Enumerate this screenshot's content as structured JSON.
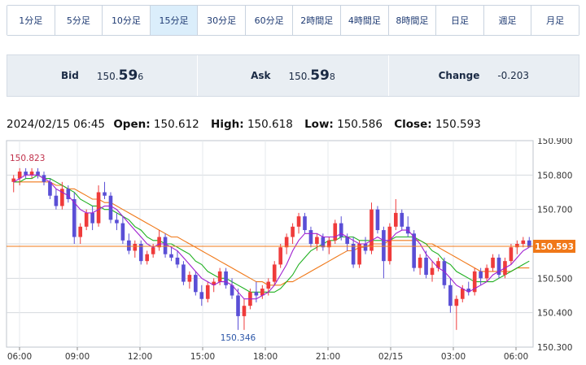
{
  "timeframes": [
    {
      "label": "1分足",
      "active": false
    },
    {
      "label": "5分足",
      "active": false
    },
    {
      "label": "10分足",
      "active": false
    },
    {
      "label": "15分足",
      "active": true
    },
    {
      "label": "30分足",
      "active": false
    },
    {
      "label": "60分足",
      "active": false
    },
    {
      "label": "2時間足",
      "active": false
    },
    {
      "label": "4時間足",
      "active": false
    },
    {
      "label": "8時間足",
      "active": false
    },
    {
      "label": "日足",
      "active": false
    },
    {
      "label": "週足",
      "active": false
    },
    {
      "label": "月足",
      "active": false
    }
  ],
  "quotes": {
    "bid": {
      "label": "Bid",
      "prefix": "150.",
      "big": "59",
      "small": "6"
    },
    "ask": {
      "label": "Ask",
      "prefix": "150.",
      "big": "59",
      "small": "8"
    },
    "change": {
      "label": "Change",
      "value": "-0.203"
    }
  },
  "ohlc": {
    "datetime": "2024/02/15 06:45",
    "open_label": "Open:",
    "open": "150.612",
    "high_label": "High:",
    "high": "150.618",
    "low_label": "Low:",
    "low": "150.586",
    "close_label": "Close:",
    "close": "150.593"
  },
  "colors": {
    "up": "#ef3b3b",
    "down": "#5a4fd6",
    "ma_fast": "#a020d0",
    "ma_mid": "#20b020",
    "ma_slow": "#f07818",
    "current_line": "#f07818"
  },
  "chart_data": {
    "type": "candlestick",
    "ylim": [
      150.3,
      150.9
    ],
    "yticks": [
      "150.900",
      "150.800",
      "150.700",
      "150.600",
      "150.500",
      "150.400",
      "150.300"
    ],
    "xticks": [
      "06:00",
      "09:00",
      "12:00",
      "15:00",
      "18:00",
      "21:00",
      "02/15",
      "03:00",
      "06:00"
    ],
    "current_price": "150.593",
    "annotations": {
      "max_label": "150.823",
      "min_label": "150.346"
    },
    "candles": [
      [
        150.78,
        150.8,
        150.75,
        150.79
      ],
      [
        150.79,
        150.82,
        150.77,
        150.81
      ],
      [
        150.81,
        150.82,
        150.79,
        150.8
      ],
      [
        150.8,
        150.82,
        150.79,
        150.81
      ],
      [
        150.81,
        150.82,
        150.79,
        150.8
      ],
      [
        150.8,
        150.81,
        150.77,
        150.78
      ],
      [
        150.78,
        150.79,
        150.73,
        150.74
      ],
      [
        150.74,
        150.76,
        150.7,
        150.71
      ],
      [
        150.71,
        150.78,
        150.7,
        150.76
      ],
      [
        150.76,
        150.77,
        150.72,
        150.73
      ],
      [
        150.73,
        150.75,
        150.6,
        150.62
      ],
      [
        150.62,
        150.66,
        150.6,
        150.65
      ],
      [
        150.65,
        150.7,
        150.64,
        150.69
      ],
      [
        150.69,
        150.71,
        150.64,
        150.66
      ],
      [
        150.66,
        150.77,
        150.65,
        150.75
      ],
      [
        150.75,
        150.78,
        150.73,
        150.74
      ],
      [
        150.74,
        150.75,
        150.66,
        150.67
      ],
      [
        150.67,
        150.69,
        150.64,
        150.66
      ],
      [
        150.66,
        150.68,
        150.6,
        150.61
      ],
      [
        150.61,
        150.63,
        150.57,
        150.58
      ],
      [
        150.58,
        150.61,
        150.56,
        150.6
      ],
      [
        150.6,
        150.61,
        150.54,
        150.55
      ],
      [
        150.55,
        150.58,
        150.54,
        150.57
      ],
      [
        150.57,
        150.6,
        150.56,
        150.59
      ],
      [
        150.59,
        150.64,
        150.58,
        150.62
      ],
      [
        150.62,
        150.63,
        150.56,
        150.57
      ],
      [
        150.57,
        150.59,
        150.55,
        150.56
      ],
      [
        150.56,
        150.58,
        150.53,
        150.54
      ],
      [
        150.54,
        150.55,
        150.48,
        150.49
      ],
      [
        150.49,
        150.52,
        150.47,
        150.51
      ],
      [
        150.51,
        150.52,
        150.45,
        150.46
      ],
      [
        150.46,
        150.48,
        150.42,
        150.44
      ],
      [
        150.44,
        150.49,
        150.43,
        150.48
      ],
      [
        150.48,
        150.5,
        150.46,
        150.49
      ],
      [
        150.49,
        150.53,
        150.48,
        150.52
      ],
      [
        150.52,
        150.53,
        150.47,
        150.48
      ],
      [
        150.48,
        150.5,
        150.44,
        150.45
      ],
      [
        150.45,
        150.47,
        150.35,
        150.39
      ],
      [
        150.39,
        150.44,
        150.35,
        150.42
      ],
      [
        150.42,
        150.47,
        150.41,
        150.46
      ],
      [
        150.46,
        150.49,
        150.43,
        150.45
      ],
      [
        150.45,
        150.48,
        150.44,
        150.47
      ],
      [
        150.47,
        150.5,
        150.45,
        150.49
      ],
      [
        150.49,
        150.55,
        150.48,
        150.54
      ],
      [
        150.54,
        150.6,
        150.53,
        150.59
      ],
      [
        150.59,
        150.63,
        150.57,
        150.62
      ],
      [
        150.62,
        150.66,
        150.6,
        150.65
      ],
      [
        150.65,
        150.69,
        150.63,
        150.68
      ],
      [
        150.68,
        150.69,
        150.63,
        150.64
      ],
      [
        150.64,
        150.65,
        150.59,
        150.6
      ],
      [
        150.6,
        150.63,
        150.58,
        150.62
      ],
      [
        150.62,
        150.63,
        150.58,
        150.59
      ],
      [
        150.59,
        150.62,
        150.57,
        150.61
      ],
      [
        150.61,
        150.67,
        150.6,
        150.66
      ],
      [
        150.66,
        150.68,
        150.61,
        150.62
      ],
      [
        150.62,
        150.63,
        150.58,
        150.6
      ],
      [
        150.6,
        150.62,
        150.53,
        150.54
      ],
      [
        150.54,
        150.61,
        150.53,
        150.6
      ],
      [
        150.6,
        150.62,
        150.57,
        150.58
      ],
      [
        150.58,
        150.72,
        150.57,
        150.7
      ],
      [
        150.7,
        150.71,
        150.63,
        150.64
      ],
      [
        150.64,
        150.65,
        150.5,
        150.55
      ],
      [
        150.55,
        150.66,
        150.54,
        150.65
      ],
      [
        150.65,
        150.73,
        150.64,
        150.69
      ],
      [
        150.69,
        150.7,
        150.64,
        150.65
      ],
      [
        150.65,
        150.68,
        150.62,
        150.63
      ],
      [
        150.63,
        150.64,
        150.52,
        150.53
      ],
      [
        150.53,
        150.57,
        150.51,
        150.56
      ],
      [
        150.56,
        150.58,
        150.5,
        150.51
      ],
      [
        150.51,
        150.55,
        150.49,
        150.53
      ],
      [
        150.53,
        150.56,
        150.52,
        150.55
      ],
      [
        150.55,
        150.56,
        150.47,
        150.48
      ],
      [
        150.48,
        150.5,
        150.4,
        150.42
      ],
      [
        150.42,
        150.45,
        150.35,
        150.44
      ],
      [
        150.44,
        150.48,
        150.43,
        150.47
      ],
      [
        150.47,
        150.49,
        150.45,
        150.46
      ],
      [
        150.46,
        150.53,
        150.45,
        150.52
      ],
      [
        150.52,
        150.53,
        150.48,
        150.5
      ],
      [
        150.5,
        150.54,
        150.49,
        150.53
      ],
      [
        150.53,
        150.57,
        150.52,
        150.56
      ],
      [
        150.56,
        150.57,
        150.5,
        150.51
      ],
      [
        150.51,
        150.56,
        150.5,
        150.55
      ],
      [
        150.55,
        150.6,
        150.54,
        150.59
      ],
      [
        150.59,
        150.61,
        150.57,
        150.6
      ],
      [
        150.6,
        150.62,
        150.59,
        150.61
      ],
      [
        150.61,
        150.62,
        150.59,
        150.59
      ]
    ],
    "ma_fast": [
      150.78,
      150.79,
      150.8,
      150.8,
      150.8,
      150.79,
      150.78,
      150.76,
      150.75,
      150.74,
      150.72,
      150.7,
      150.69,
      150.69,
      150.7,
      150.71,
      150.71,
      150.7,
      150.68,
      150.66,
      150.64,
      150.62,
      150.6,
      150.59,
      150.6,
      150.6,
      150.59,
      150.58,
      150.56,
      150.54,
      150.52,
      150.5,
      150.49,
      150.48,
      150.49,
      150.49,
      150.48,
      150.46,
      150.44,
      150.44,
      150.44,
      150.45,
      150.46,
      150.48,
      150.51,
      150.54,
      150.58,
      150.61,
      150.63,
      150.63,
      150.63,
      150.62,
      150.62,
      150.62,
      150.63,
      150.62,
      150.61,
      150.6,
      150.6,
      150.61,
      150.62,
      150.61,
      150.61,
      150.63,
      150.64,
      150.64,
      150.62,
      150.6,
      150.57,
      150.55,
      150.53,
      150.52,
      150.5,
      150.48,
      150.47,
      150.46,
      150.47,
      150.48,
      150.49,
      150.51,
      150.52,
      150.53,
      150.54,
      150.56,
      150.58,
      150.59
    ],
    "ma_mid": [
      150.78,
      150.78,
      150.79,
      150.79,
      150.8,
      150.79,
      150.79,
      150.78,
      150.77,
      150.76,
      150.75,
      150.73,
      150.72,
      150.71,
      150.71,
      150.7,
      150.7,
      150.69,
      150.68,
      150.67,
      150.65,
      150.64,
      150.62,
      150.61,
      150.61,
      150.6,
      150.6,
      150.59,
      150.58,
      150.57,
      150.55,
      150.54,
      150.52,
      150.51,
      150.5,
      150.5,
      150.49,
      150.48,
      150.47,
      150.46,
      150.46,
      150.46,
      150.46,
      150.46,
      150.47,
      150.49,
      150.51,
      150.54,
      150.56,
      150.58,
      150.59,
      150.6,
      150.61,
      150.61,
      150.62,
      150.62,
      150.62,
      150.61,
      150.61,
      150.61,
      150.61,
      150.61,
      150.61,
      150.62,
      150.62,
      150.62,
      150.62,
      150.61,
      150.6,
      150.58,
      150.57,
      150.55,
      150.54,
      150.52,
      150.51,
      150.5,
      150.49,
      150.49,
      150.49,
      150.49,
      150.5,
      150.51,
      150.52,
      150.53,
      150.54,
      150.55
    ],
    "ma_slow": [
      150.78,
      150.78,
      150.78,
      150.78,
      150.78,
      150.78,
      150.78,
      150.77,
      150.77,
      150.76,
      150.76,
      150.75,
      150.74,
      150.73,
      150.73,
      150.72,
      150.72,
      150.71,
      150.7,
      150.69,
      150.68,
      150.67,
      150.66,
      150.65,
      150.64,
      150.63,
      150.62,
      150.62,
      150.61,
      150.6,
      150.59,
      150.58,
      150.57,
      150.56,
      150.55,
      150.54,
      150.53,
      150.52,
      150.51,
      150.5,
      150.49,
      150.49,
      150.48,
      150.48,
      150.48,
      150.49,
      150.49,
      150.5,
      150.51,
      150.52,
      150.53,
      150.54,
      150.55,
      150.56,
      150.57,
      150.58,
      150.58,
      150.59,
      150.59,
      150.6,
      150.6,
      150.6,
      150.61,
      150.61,
      150.61,
      150.61,
      150.61,
      150.61,
      150.6,
      150.6,
      150.59,
      150.58,
      150.57,
      150.56,
      150.55,
      150.54,
      150.53,
      150.52,
      150.52,
      150.52,
      150.52,
      150.52,
      150.52,
      150.53,
      150.53,
      150.53
    ]
  }
}
